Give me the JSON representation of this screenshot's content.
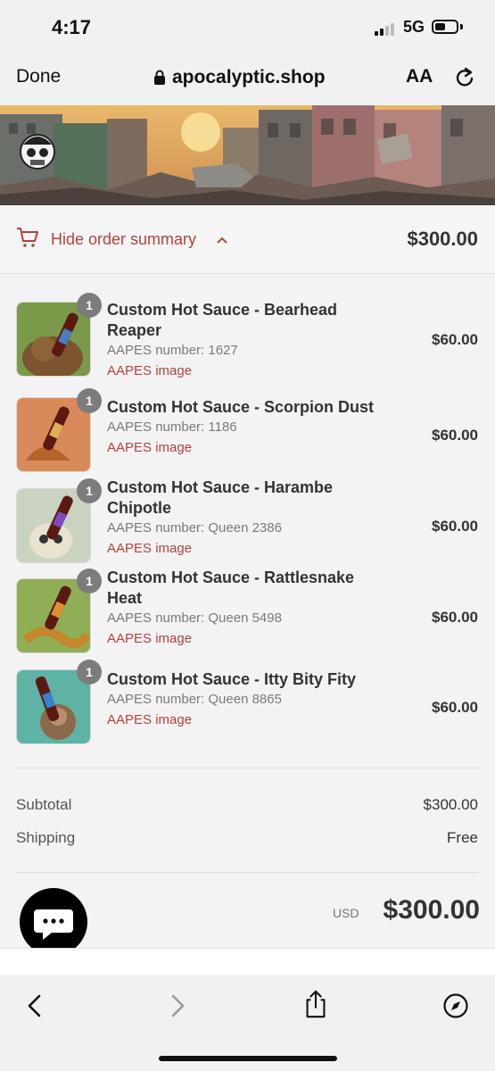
{
  "status": {
    "time": "4:17",
    "network": "5G"
  },
  "browser": {
    "done_label": "Done",
    "url": "apocalyptic.shop",
    "text_size_label": "AA"
  },
  "summary": {
    "toggle_label": "Hide order summary",
    "total": "$300.00"
  },
  "items": [
    {
      "qty": "1",
      "name_line1": "Custom Hot Sauce - Bearhead",
      "name_line2": "Reaper",
      "number": "AAPES number: 1627",
      "image_link": "AAPES image",
      "price": "$60.00"
    },
    {
      "qty": "1",
      "name_line1": "Custom Hot Sauce - Scorpion Dust",
      "name_line2": "",
      "number": "AAPES number: 1186",
      "image_link": "AAPES image",
      "price": "$60.00"
    },
    {
      "qty": "1",
      "name_line1": "Custom Hot Sauce - Harambe",
      "name_line2": "Chipotle",
      "number": "AAPES number: Queen 2386",
      "image_link": "AAPES image",
      "price": "$60.00"
    },
    {
      "qty": "1",
      "name_line1": "Custom Hot Sauce - Rattlesnake",
      "name_line2": "Heat",
      "number": "AAPES number: Queen 5498",
      "image_link": "AAPES image",
      "price": "$60.00"
    },
    {
      "qty": "1",
      "name_line1": "Custom Hot Sauce - Itty Bity Fity",
      "name_line2": "",
      "number": "AAPES number: Queen 8865",
      "image_link": "AAPES image",
      "price": "$60.00"
    }
  ],
  "totals": {
    "subtotal_label": "Subtotal",
    "subtotal_value": "$300.00",
    "shipping_label": "Shipping",
    "shipping_value": "Free",
    "currency": "USD",
    "grand_total": "$300.00"
  },
  "colors": {
    "accent": "#b6423d",
    "text": "#333333",
    "background": "#f4f3f3"
  },
  "icons": [
    "lock-icon",
    "reload-icon",
    "cart-icon",
    "chevron-up-icon",
    "chat-icon",
    "back-icon",
    "forward-icon",
    "share-icon",
    "compass-icon"
  ]
}
